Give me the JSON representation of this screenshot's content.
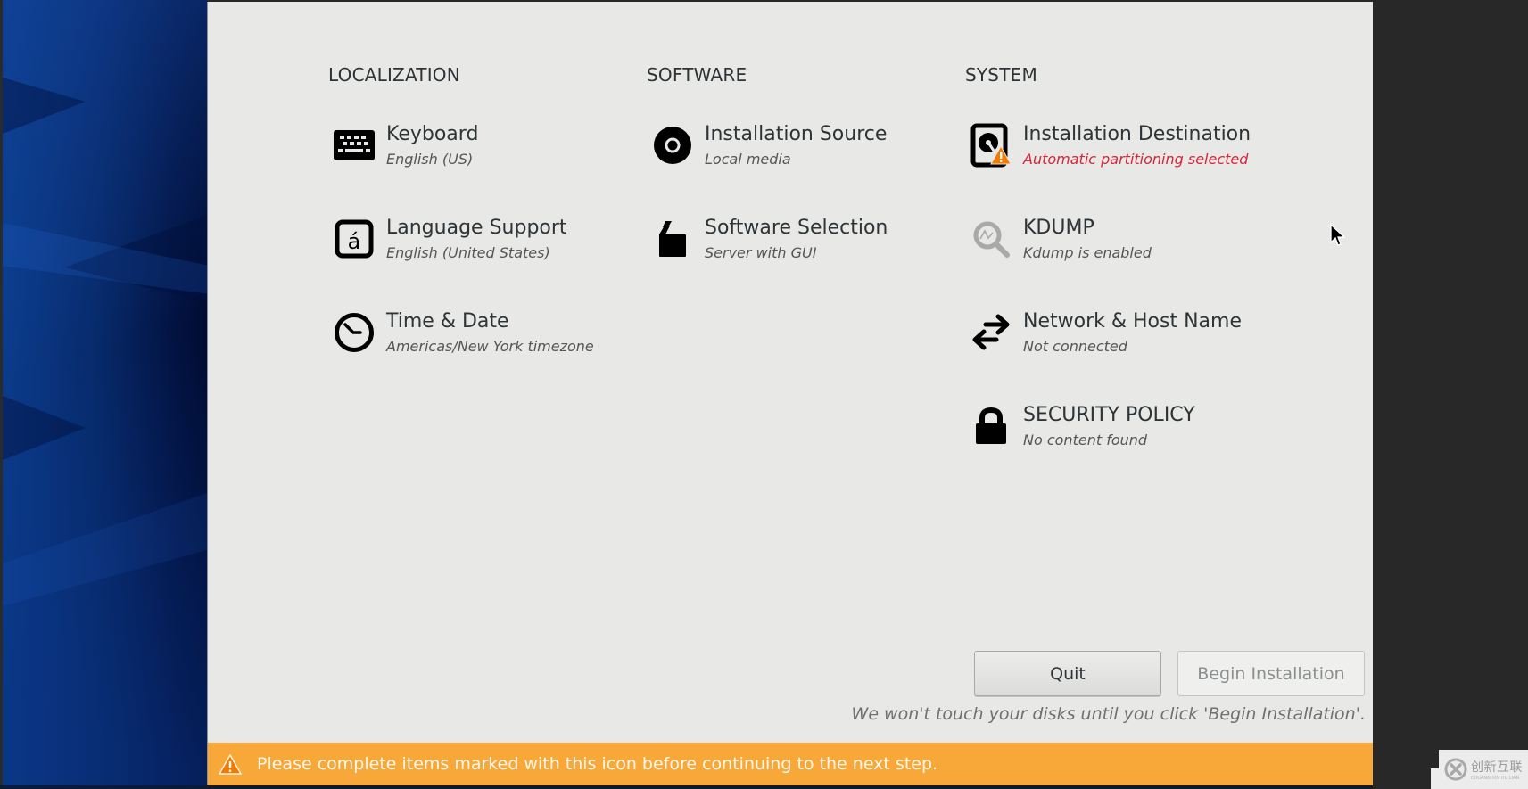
{
  "sections": {
    "localization": {
      "title": "LOCALIZATION",
      "spokes": [
        {
          "icon": "keyboard-icon",
          "title": "Keyboard",
          "status": "English (US)"
        },
        {
          "icon": "language-icon",
          "title": "Language Support",
          "status": "English (United States)"
        },
        {
          "icon": "clock-icon",
          "title": "Time & Date",
          "status": "Americas/New York timezone"
        }
      ]
    },
    "software": {
      "title": "SOFTWARE",
      "spokes": [
        {
          "icon": "disc-icon",
          "title": "Installation Source",
          "status": "Local media"
        },
        {
          "icon": "package-icon",
          "title": "Software Selection",
          "status": "Server with GUI"
        }
      ]
    },
    "system": {
      "title": "SYSTEM",
      "spokes": [
        {
          "icon": "harddisk-warning-icon",
          "title": "Installation Destination",
          "status": "Automatic partitioning selected",
          "warning": true
        },
        {
          "icon": "kdump-search-icon",
          "title": "KDUMP",
          "status": "Kdump is enabled"
        },
        {
          "icon": "network-arrows-icon",
          "title": "Network & Host Name",
          "status": "Not connected"
        },
        {
          "icon": "lock-icon",
          "title": "SECURITY POLICY",
          "status": "No content found"
        }
      ]
    }
  },
  "actions": {
    "quit_label": "Quit",
    "begin_label": "Begin Installation",
    "begin_enabled": false,
    "note": "We won't touch your disks until you click 'Begin Installation'."
  },
  "warning_bar": {
    "icon": "warning-triangle-icon",
    "text": "Please complete items marked with this icon before continuing to the next step."
  },
  "watermark": {
    "text_cn": "创新互联",
    "text_en": "CHUANG XIN HU LIAN"
  },
  "colors": {
    "warning_orange": "#f8a838",
    "status_error_red": "#d6263a",
    "panel_bg": "#e8e8e7",
    "sidebar_blue": "#072a6a"
  }
}
